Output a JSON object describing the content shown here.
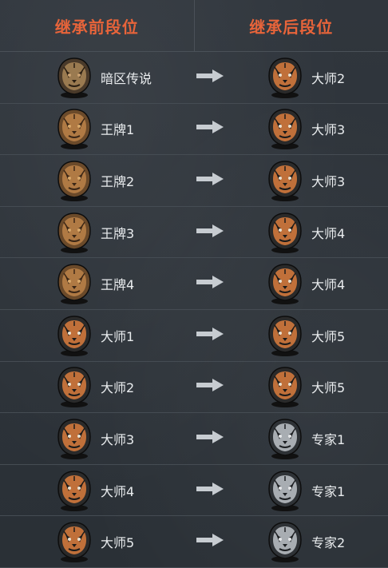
{
  "header": {
    "before_label": "继承前段位",
    "after_label": "继承后段位"
  },
  "colors": {
    "header_text": "#e8643a",
    "body_text": "#e9ecee",
    "arrow": "#c7ccd1"
  },
  "rows": [
    {
      "before": {
        "label": "暗区传说",
        "badge": "dark-legend-lion-badge-icon"
      },
      "after": {
        "label": "大师2",
        "badge": "master-tiger-badge-icon"
      }
    },
    {
      "before": {
        "label": "王牌1",
        "badge": "ace-lion-badge-icon"
      },
      "after": {
        "label": "大师3",
        "badge": "master-tiger-badge-icon"
      }
    },
    {
      "before": {
        "label": "王牌2",
        "badge": "ace-lion-badge-icon"
      },
      "after": {
        "label": "大师3",
        "badge": "master-tiger-badge-icon"
      }
    },
    {
      "before": {
        "label": "王牌3",
        "badge": "ace-lion-badge-icon"
      },
      "after": {
        "label": "大师4",
        "badge": "master-tiger-badge-icon"
      }
    },
    {
      "before": {
        "label": "王牌4",
        "badge": "ace-lion-badge-icon"
      },
      "after": {
        "label": "大师4",
        "badge": "master-tiger-badge-icon"
      }
    },
    {
      "before": {
        "label": "大师1",
        "badge": "master-tiger-badge-icon"
      },
      "after": {
        "label": "大师5",
        "badge": "master-tiger-badge-icon"
      }
    },
    {
      "before": {
        "label": "大师2",
        "badge": "master-tiger-badge-icon"
      },
      "after": {
        "label": "大师5",
        "badge": "master-tiger-badge-icon"
      }
    },
    {
      "before": {
        "label": "大师3",
        "badge": "master-tiger-badge-icon"
      },
      "after": {
        "label": "专家1",
        "badge": "expert-wolf-badge-icon"
      }
    },
    {
      "before": {
        "label": "大师4",
        "badge": "master-tiger-badge-icon"
      },
      "after": {
        "label": "专家1",
        "badge": "expert-wolf-badge-icon"
      }
    },
    {
      "before": {
        "label": "大师5",
        "badge": "master-tiger-badge-icon"
      },
      "after": {
        "label": "专家2",
        "badge": "expert-wolf-badge-icon"
      }
    }
  ]
}
